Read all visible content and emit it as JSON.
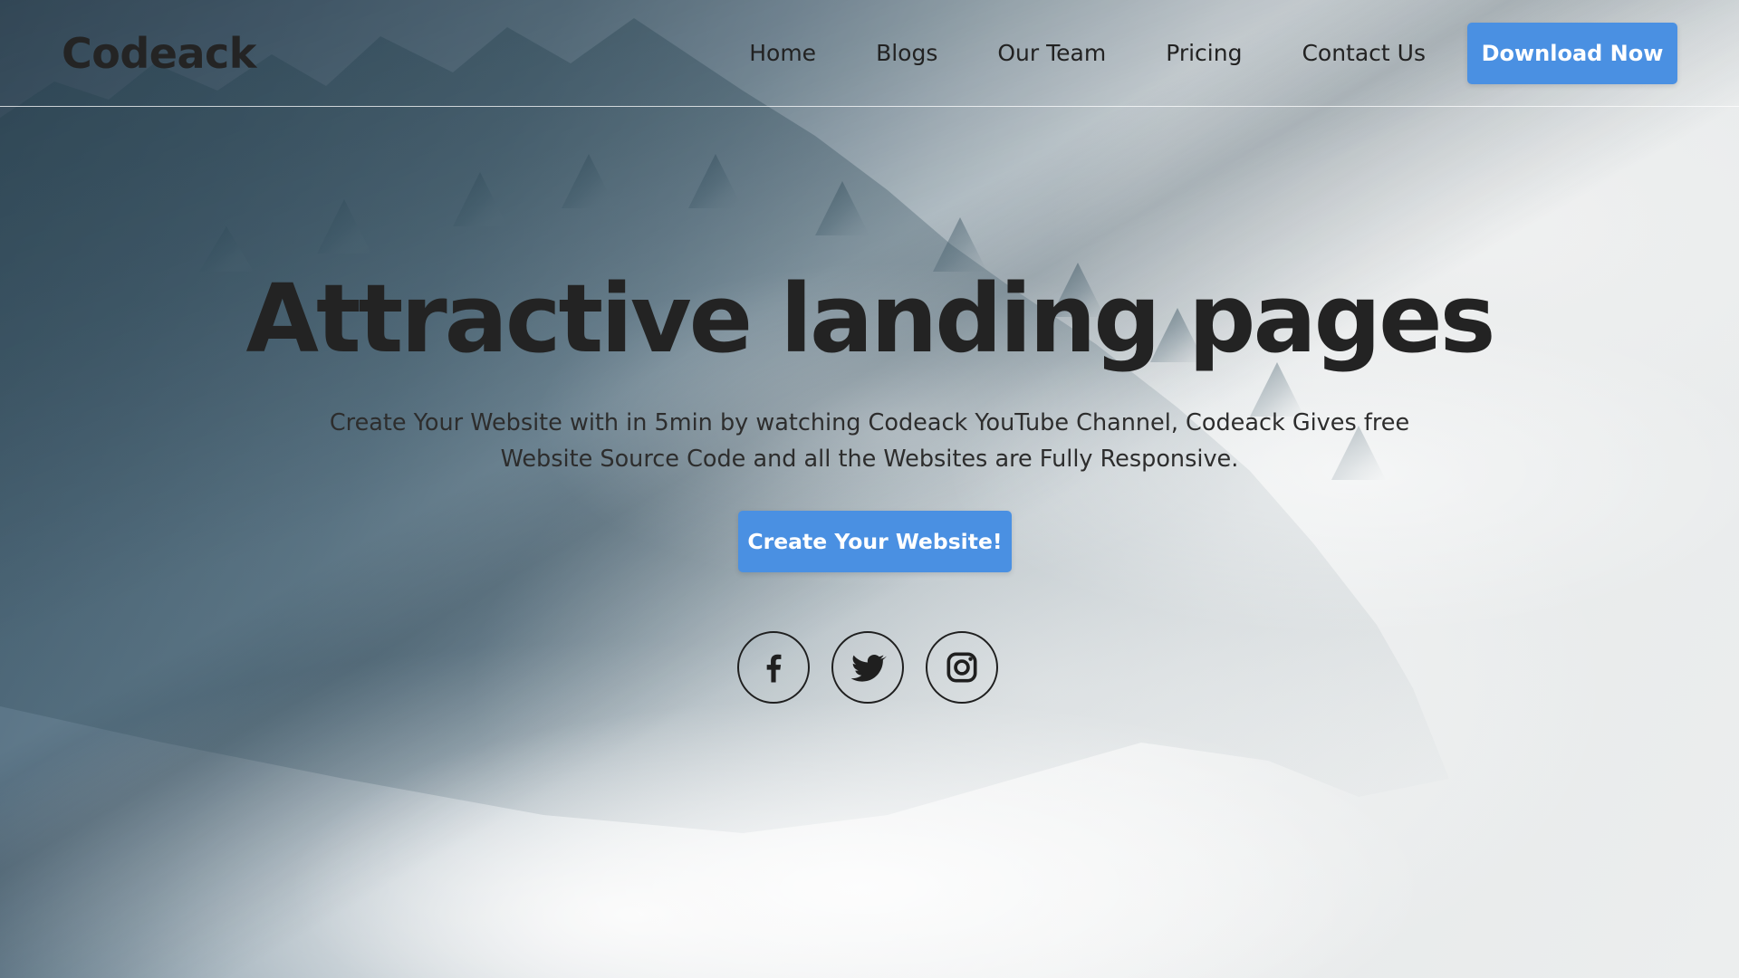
{
  "brand": {
    "name": "Codeack"
  },
  "nav": {
    "items": [
      {
        "label": "Home"
      },
      {
        "label": "Blogs"
      },
      {
        "label": "Our Team"
      },
      {
        "label": "Pricing"
      },
      {
        "label": "Contact Us"
      }
    ],
    "cta_label": "Download Now"
  },
  "hero": {
    "title": "Attractive landing pages",
    "subtitle": "Create Your Website with in 5min by watching Codeack YouTube Channel, Codeack Gives free Website Source Code and all the Websites are Fully Responsive.",
    "cta_label": "Create Your Website!"
  },
  "social": {
    "icons": [
      "facebook-icon",
      "twitter-icon",
      "instagram-icon"
    ]
  },
  "colors": {
    "accent": "#4a90e2",
    "text": "#232323"
  }
}
